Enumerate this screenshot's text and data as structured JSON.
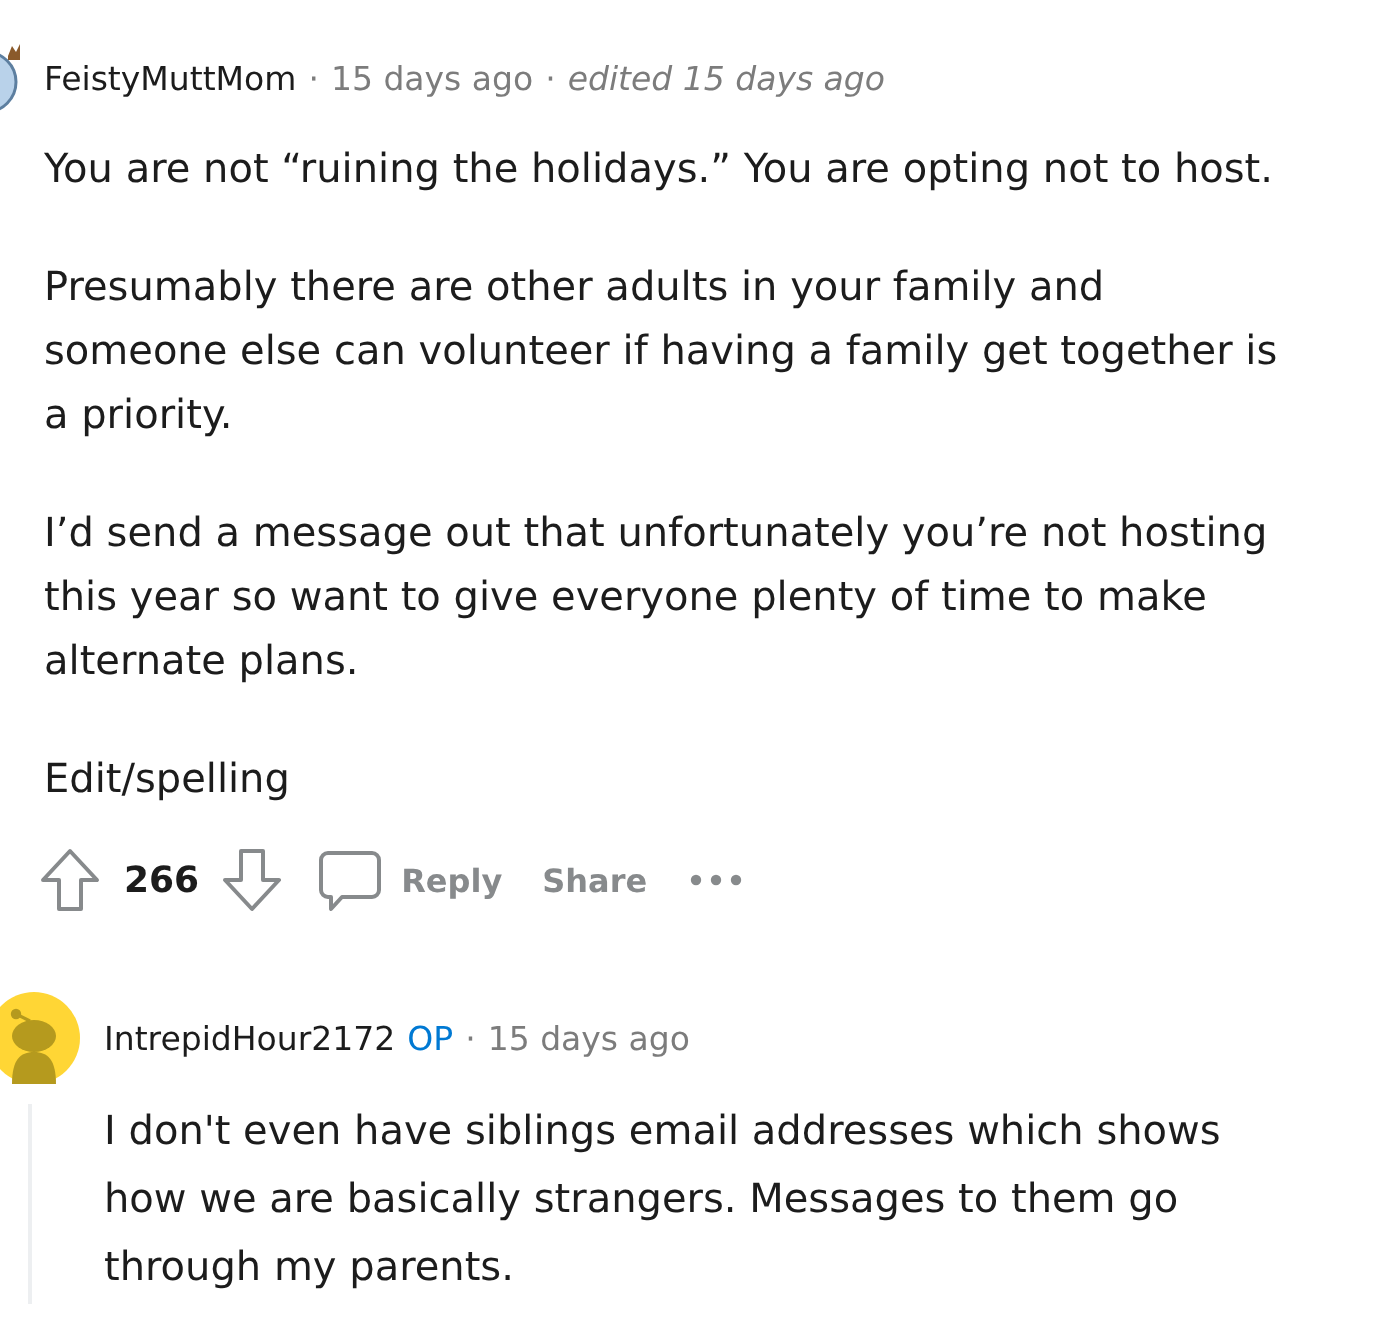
{
  "comments": [
    {
      "author": "FeistyMuttMom",
      "meta": [
        {
          "kind": "time",
          "separator": "·",
          "text": "15 days ago"
        },
        {
          "kind": "edited",
          "separator": "·",
          "text": "edited 15 days ago"
        }
      ],
      "paragraphs": [
        "You are not “ruining the holidays.” You are opting not to host.",
        "Presumably there are other adults in your family and someone else can volunteer if having a family get together is a priority.",
        "I’d send a message out that unfortunately you’re not hosting this year so want to give everyone plenty of time to make alternate plans.",
        "Edit/spelling"
      ],
      "score": "266",
      "actions": [
        {
          "kind": "reply",
          "label": "Reply"
        },
        {
          "kind": "share",
          "label": "Share"
        },
        {
          "kind": "more"
        }
      ],
      "replies": [
        {
          "author": "IntrepidHour2172",
          "badge": "OP",
          "meta": [
            {
              "kind": "time",
              "separator": "·",
              "text": "15 days ago"
            }
          ],
          "paragraphs": [
            "I don't even have siblings email addresses which shows how we are basically strangers. Messages to them go through my parents."
          ]
        }
      ]
    }
  ]
}
